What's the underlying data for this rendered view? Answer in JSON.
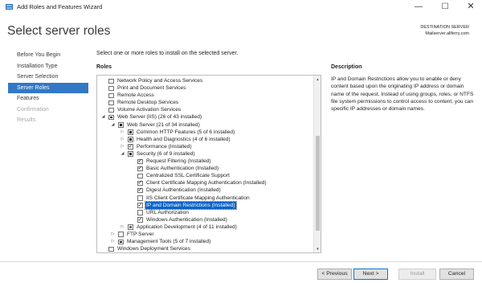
{
  "window": {
    "title": "Add Roles and Features Wizard",
    "min_glyph": "—",
    "max_glyph": "☐",
    "close_glyph": "✕"
  },
  "header": {
    "page_title": "Select server roles",
    "destination_label": "DESTINATION SERVER",
    "destination_value": "Mailserver.allferry.com"
  },
  "nav": [
    {
      "label": "Before You Begin",
      "state": "normal"
    },
    {
      "label": "Installation Type",
      "state": "normal"
    },
    {
      "label": "Server Selection",
      "state": "normal"
    },
    {
      "label": "Server Roles",
      "state": "selected"
    },
    {
      "label": "Features",
      "state": "normal"
    },
    {
      "label": "Confirmation",
      "state": "disabled"
    },
    {
      "label": "Results",
      "state": "disabled"
    }
  ],
  "main": {
    "instruction": "Select one or more roles to install on the selected server.",
    "roles_heading": "Roles",
    "roles_tree": [
      {
        "level": 0,
        "expander": "",
        "check": "unchecked",
        "label": "Network Policy and Access Services"
      },
      {
        "level": 0,
        "expander": "",
        "check": "unchecked",
        "label": "Print and Document Services"
      },
      {
        "level": 0,
        "expander": "",
        "check": "unchecked",
        "label": "Remote Access"
      },
      {
        "level": 0,
        "expander": "",
        "check": "unchecked",
        "label": "Remote Desktop Services"
      },
      {
        "level": 0,
        "expander": "",
        "check": "unchecked",
        "label": "Volume Activation Services"
      },
      {
        "level": 0,
        "expander": "expanded",
        "check": "partial",
        "label": "Web Server (IIS) (26 of 43 installed)"
      },
      {
        "level": 1,
        "expander": "expanded",
        "check": "partial",
        "label": "Web Server (21 of 34 installed)"
      },
      {
        "level": 2,
        "expander": "collapsed",
        "check": "partial",
        "label": "Common HTTP Features (5 of 6 installed)"
      },
      {
        "level": 2,
        "expander": "collapsed",
        "check": "partial",
        "label": "Health and Diagnostics (4 of 6 installed)"
      },
      {
        "level": 2,
        "expander": "collapsed",
        "check": "checked",
        "label": "Performance (Installed)"
      },
      {
        "level": 2,
        "expander": "expanded",
        "check": "partial",
        "label": "Security (6 of 9 installed)"
      },
      {
        "level": 3,
        "expander": "",
        "check": "checked",
        "label": "Request Filtering (Installed)"
      },
      {
        "level": 3,
        "expander": "",
        "check": "checked",
        "label": "Basic Authentication (Installed)"
      },
      {
        "level": 3,
        "expander": "",
        "check": "unchecked",
        "label": "Centralized SSL Certificate Support"
      },
      {
        "level": 3,
        "expander": "",
        "check": "checked",
        "label": "Client Certificate Mapping Authentication (Installed)"
      },
      {
        "level": 3,
        "expander": "",
        "check": "checked",
        "label": "Digest Authentication (Installed)"
      },
      {
        "level": 3,
        "expander": "",
        "check": "unchecked",
        "label": "IIS Client Certificate Mapping Authentication"
      },
      {
        "level": 3,
        "expander": "",
        "check": "checked",
        "label": "IP and Domain Restrictions (Installed)",
        "highlighted": true
      },
      {
        "level": 3,
        "expander": "",
        "check": "unchecked",
        "label": "URL Authorization"
      },
      {
        "level": 3,
        "expander": "",
        "check": "checked",
        "label": "Windows Authentication (Installed)"
      },
      {
        "level": 2,
        "expander": "collapsed",
        "check": "partial-gray",
        "label": "Application Development (4 of 11 installed)"
      },
      {
        "level": 1,
        "expander": "collapsed",
        "check": "unchecked",
        "label": "FTP Server"
      },
      {
        "level": 1,
        "expander": "collapsed",
        "check": "partial",
        "label": "Management Tools (5 of 7 installed)"
      },
      {
        "level": 0,
        "expander": "",
        "check": "unchecked",
        "label": "Windows Deployment Services"
      }
    ],
    "scroll_up_glyph": "▲",
    "scroll_down_glyph": "▼"
  },
  "description": {
    "heading": "Description",
    "text": "IP and Domain Restrictions allow you to enable or deny content based upon the originating IP address or domain name of the request. Instead of using groups, roles, or NTFS file system permissions to control access to content, you can specific IP addresses or domain names."
  },
  "buttons": {
    "previous": "< Previous",
    "next": "Next >",
    "install": "Install",
    "cancel": "Cancel"
  },
  "icons": {
    "app": "server-manager-icon",
    "expanded": "triangle-expanded-icon",
    "collapsed": "triangle-collapsed-icon"
  }
}
